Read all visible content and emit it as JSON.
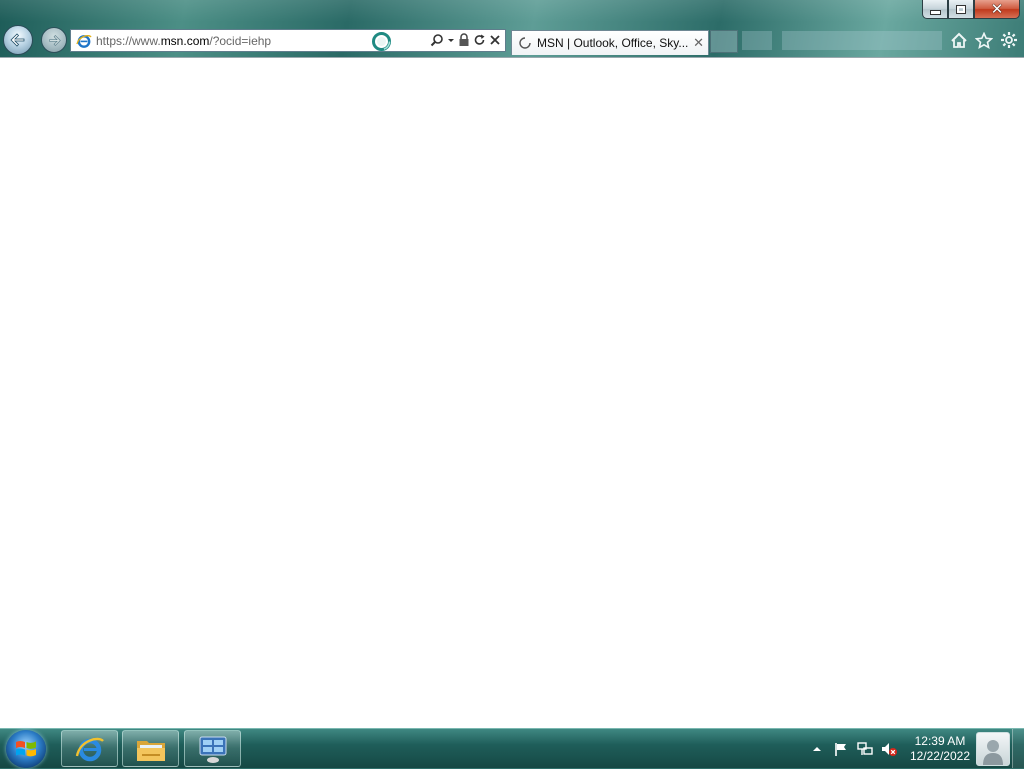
{
  "window": {
    "caption_buttons": {
      "minimize": "minimize-icon",
      "restore": "restore-icon",
      "close": "close-icon"
    }
  },
  "toolbar": {
    "back": "back-arrow-icon",
    "forward": "forward-arrow-icon"
  },
  "address_bar": {
    "prefix": "https://www.",
    "domain": "msn.com",
    "suffix": "/?ocid=iehp",
    "icons": [
      "ie-icon",
      "loading-spinner-icon",
      "search-icon",
      "dropdown-icon",
      "lock-icon",
      "refresh-icon",
      "stop-icon"
    ]
  },
  "tabs": [
    {
      "title": "MSN | Outlook, Office, Sky...",
      "state": "loading",
      "close": "close-icon"
    }
  ],
  "command_icons": [
    "home-icon",
    "favorites-star-icon",
    "tools-gear-icon"
  ],
  "taskbar": {
    "start": "windows-start-icon",
    "pinned": [
      "internet-explorer-icon",
      "file-explorer-icon",
      "control-panel-icon"
    ],
    "tray": {
      "icons": [
        "show-hidden-icons-icon",
        "action-center-flag-icon",
        "network-icon",
        "volume-muted-icon"
      ],
      "time": "12:39 AM",
      "date": "12/22/2022"
    }
  },
  "colors": {
    "frame": "#2f6f6a",
    "taskbar": "#1f5e5a",
    "content": "#ffffff",
    "close_button": "#c0391c"
  }
}
